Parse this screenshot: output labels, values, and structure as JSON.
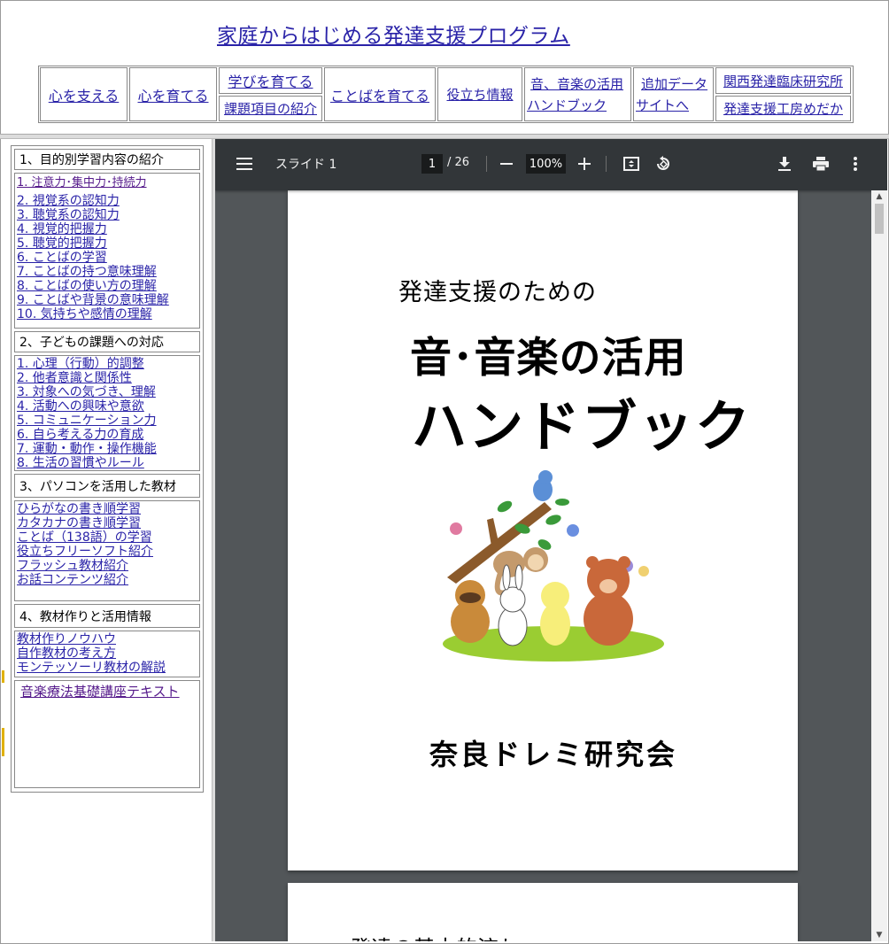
{
  "header": {
    "site_title": "家庭からはじめる発達支援プログラム",
    "nav": {
      "kokoro_sasaeru": "心を支える",
      "kokoro_sodateru": "心を育てる",
      "manabi_sodateru": "学びを育てる",
      "kadai_shokai": "課題項目の紹介",
      "kotoba_sodateru": "ことばを育てる",
      "yakudachi": "役立ち情報",
      "ongaku_katsuyo": "音、音楽の活用",
      "handbook": "ハンドブック",
      "tsuika_data": "追加データ",
      "site_he": "サイトへ",
      "kansai": "関西発達臨床研究所",
      "medaka": "発達支援工房めだか"
    }
  },
  "sidebar": {
    "sections": [
      {
        "heading": "1、目的別学習内容の紹介",
        "links": [
          "1. 注意力･集中力･持続力",
          "2. 視覚系の認知力",
          "3. 聴覚系の認知力",
          "4. 視覚的把握力",
          "5. 聴覚的把握力",
          "6. ことばの学習",
          "7. ことばの持つ意味理解",
          "8. ことばの使い方の理解",
          "9. ことばや背景の意味理解",
          "10. 気持ちや感情の理解"
        ]
      },
      {
        "heading": "2、子どもの課題への対応",
        "links": [
          "1. 心理（行動）的調整",
          "2. 他者意識と関係性",
          "3. 対象への気づき、理解",
          "4. 活動への興味や意欲",
          "5. コミュニケーション力",
          "6. 自ら考える力の育成",
          "7. 運動・動作・操作機能",
          "8. 生活の習慣やルール"
        ]
      },
      {
        "heading": "3、パソコンを活用した教材",
        "links": [
          "ひらがなの書き順学習",
          "カタカナの書き順学習",
          "ことば（138語）の学習",
          "役立ちフリーソフト紹介",
          "フラッシュ教材紹介",
          "お話コンテンツ紹介"
        ]
      },
      {
        "heading": "4、教材作りと活用情報",
        "links": [
          "教材作りノウハウ",
          "自作教材の考え方",
          "モンテッソーリ教材の解説"
        ]
      }
    ],
    "extra_link": "音楽療法基礎講座テキスト"
  },
  "pdf_viewer": {
    "document_title": "スライド 1",
    "current_page": "1",
    "total_pages": "/ 26",
    "zoom": "100%",
    "icons": {
      "menu": "hamburger-menu-icon",
      "zoom_out": "minus-icon",
      "zoom_in": "plus-icon",
      "fit": "fit-page-icon",
      "rotate": "rotate-icon",
      "download": "download-icon",
      "print": "print-icon",
      "more": "more-vertical-icon"
    },
    "page1": {
      "subtitle": "発達支援のための",
      "title_line1": "音･音楽の活用",
      "title_line2": "ハンドブック",
      "author": "奈良ドレミ研究会"
    },
    "page2": {
      "heading": "発達の基本的流れ"
    }
  },
  "colors": {
    "link": "#2a23a8",
    "visited_link": "#551a8b",
    "viewer_bg": "#525659",
    "toolbar_bg": "#323639"
  }
}
